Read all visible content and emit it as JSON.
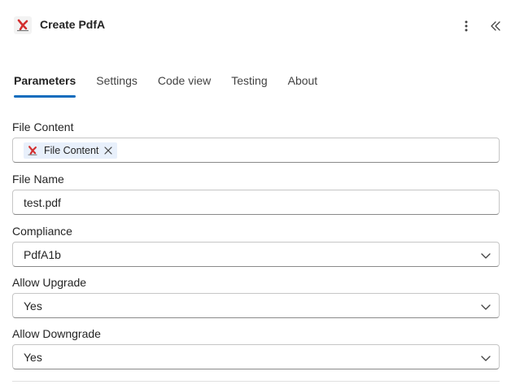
{
  "header": {
    "title": "Create PdfA",
    "app_icon": "adobe-pdf-app-icon",
    "more_icon": "more-vertical-icon",
    "collapse_icon": "double-chevron-left-icon"
  },
  "tabs": [
    {
      "label": "Parameters",
      "active": true
    },
    {
      "label": "Settings",
      "active": false
    },
    {
      "label": "Code view",
      "active": false
    },
    {
      "label": "Testing",
      "active": false
    },
    {
      "label": "About",
      "active": false
    }
  ],
  "fields": {
    "file_content": {
      "label": "File Content",
      "token_label": "File Content"
    },
    "file_name": {
      "label": "File Name",
      "value": "test.pdf"
    },
    "compliance": {
      "label": "Compliance",
      "value": "PdfA1b"
    },
    "allow_upgrade": {
      "label": "Allow Upgrade",
      "value": "Yes"
    },
    "allow_downgrade": {
      "label": "Allow Downgrade",
      "value": "Yes"
    }
  },
  "colors": {
    "accent": "#0f6cbd",
    "token_bg": "#e8f0fb",
    "brand_red": "#d32f2f"
  }
}
